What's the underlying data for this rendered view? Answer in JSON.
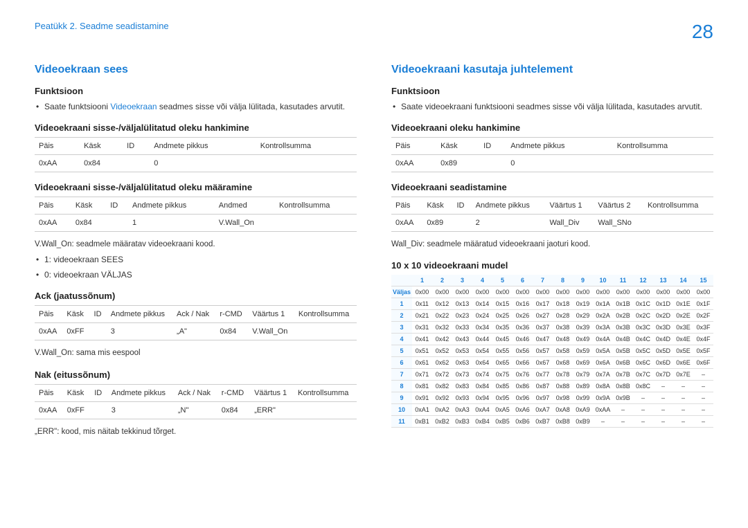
{
  "header": {
    "breadcrumb": "Peatükk 2. Seadme seadistamine",
    "page": "28"
  },
  "left": {
    "title": "Videoekraan sees",
    "func_label": "Funktsioon",
    "func_bullet_pre": "Saate funktsiooni ",
    "func_bullet_hl": "Videoekraan",
    "func_bullet_post": " seadmes sisse või välja lülitada, kasutades arvutit.",
    "get_title": "Videoekraani sisse-/väljalülitatud oleku hankimine",
    "get_headers": [
      "Päis",
      "Käsk",
      "ID",
      "Andmete pikkus",
      "Kontrollsumma"
    ],
    "get_row": [
      "0xAA",
      "0x84",
      "",
      "0",
      ""
    ],
    "set_title": "Videoekraani sisse-/väljalülitatud oleku määramine",
    "set_headers": [
      "Päis",
      "Käsk",
      "ID",
      "Andmete pikkus",
      "Andmed",
      "Kontrollsumma"
    ],
    "set_row": [
      "0xAA",
      "0x84",
      "",
      "1",
      "V.Wall_On",
      ""
    ],
    "note1": "V.Wall_On: seadmele määratav videoekraani kood.",
    "note2": "1: videoekraan SEES",
    "note3": "0: videoekraan VÄLJAS",
    "ack_title": "Ack (jaatussõnum)",
    "ack_headers": [
      "Päis",
      "Käsk",
      "ID",
      "Andmete pikkus",
      "Ack / Nak",
      "r-CMD",
      "Väärtus 1",
      "Kontrollsumma"
    ],
    "ack_row": [
      "0xAA",
      "0xFF",
      "",
      "3",
      "„A\"",
      "0x84",
      "V.Wall_On",
      ""
    ],
    "ack_note": "V.Wall_On: sama mis eespool",
    "nak_title": "Nak (eitussõnum)",
    "nak_headers": [
      "Päis",
      "Käsk",
      "ID",
      "Andmete pikkus",
      "Ack / Nak",
      "r-CMD",
      "Väärtus 1",
      "Kontrollsumma"
    ],
    "nak_row": [
      "0xAA",
      "0xFF",
      "",
      "3",
      "„N\"",
      "0x84",
      "„ERR\"",
      ""
    ],
    "nak_note": "„ERR\": kood, mis näitab tekkinud tõrget."
  },
  "right": {
    "title": "Videoekraani kasutaja juhtelement",
    "func_label": "Funktsioon",
    "func_bullet": "Saate videoekraani funktsiooni seadmes sisse või välja lülitada, kasutades arvutit.",
    "get_title": "Videoekraani oleku hankimine",
    "get_headers": [
      "Päis",
      "Käsk",
      "ID",
      "Andmete pikkus",
      "Kontrollsumma"
    ],
    "get_row": [
      "0xAA",
      "0x89",
      "",
      "0",
      ""
    ],
    "set_title": "Videoekraani seadistamine",
    "set_headers": [
      "Päis",
      "Käsk",
      "ID",
      "Andmete pikkus",
      "Väärtus 1",
      "Väärtus 2",
      "Kontrollsumma"
    ],
    "set_row": [
      "0xAA",
      "0x89",
      "",
      "2",
      "Wall_Div",
      "Wall_SNo",
      ""
    ],
    "note1": "Wall_Div: seadmele määratud videoekraani jaoturi kood.",
    "grid_title": "10 x 10 videoekraani mudel",
    "grid_cols": [
      "",
      "1",
      "2",
      "3",
      "4",
      "5",
      "6",
      "7",
      "8",
      "9",
      "10",
      "11",
      "12",
      "13",
      "14",
      "15"
    ],
    "grid_rows": [
      [
        "Väljas",
        "0x00",
        "0x00",
        "0x00",
        "0x00",
        "0x00",
        "0x00",
        "0x00",
        "0x00",
        "0x00",
        "0x00",
        "0x00",
        "0x00",
        "0x00",
        "0x00",
        "0x00"
      ],
      [
        "1",
        "0x11",
        "0x12",
        "0x13",
        "0x14",
        "0x15",
        "0x16",
        "0x17",
        "0x18",
        "0x19",
        "0x1A",
        "0x1B",
        "0x1C",
        "0x1D",
        "0x1E",
        "0x1F"
      ],
      [
        "2",
        "0x21",
        "0x22",
        "0x23",
        "0x24",
        "0x25",
        "0x26",
        "0x27",
        "0x28",
        "0x29",
        "0x2A",
        "0x2B",
        "0x2C",
        "0x2D",
        "0x2E",
        "0x2F"
      ],
      [
        "3",
        "0x31",
        "0x32",
        "0x33",
        "0x34",
        "0x35",
        "0x36",
        "0x37",
        "0x38",
        "0x39",
        "0x3A",
        "0x3B",
        "0x3C",
        "0x3D",
        "0x3E",
        "0x3F"
      ],
      [
        "4",
        "0x41",
        "0x42",
        "0x43",
        "0x44",
        "0x45",
        "0x46",
        "0x47",
        "0x48",
        "0x49",
        "0x4A",
        "0x4B",
        "0x4C",
        "0x4D",
        "0x4E",
        "0x4F"
      ],
      [
        "5",
        "0x51",
        "0x52",
        "0x53",
        "0x54",
        "0x55",
        "0x56",
        "0x57",
        "0x58",
        "0x59",
        "0x5A",
        "0x5B",
        "0x5C",
        "0x5D",
        "0x5E",
        "0x5F"
      ],
      [
        "6",
        "0x61",
        "0x62",
        "0x63",
        "0x64",
        "0x65",
        "0x66",
        "0x67",
        "0x68",
        "0x69",
        "0x6A",
        "0x6B",
        "0x6C",
        "0x6D",
        "0x6E",
        "0x6F"
      ],
      [
        "7",
        "0x71",
        "0x72",
        "0x73",
        "0x74",
        "0x75",
        "0x76",
        "0x77",
        "0x78",
        "0x79",
        "0x7A",
        "0x7B",
        "0x7C",
        "0x7D",
        "0x7E",
        "–"
      ],
      [
        "8",
        "0x81",
        "0x82",
        "0x83",
        "0x84",
        "0x85",
        "0x86",
        "0x87",
        "0x88",
        "0x89",
        "0x8A",
        "0x8B",
        "0x8C",
        "–",
        "–",
        "–"
      ],
      [
        "9",
        "0x91",
        "0x92",
        "0x93",
        "0x94",
        "0x95",
        "0x96",
        "0x97",
        "0x98",
        "0x99",
        "0x9A",
        "0x9B",
        "–",
        "–",
        "–",
        "–"
      ],
      [
        "10",
        "0xA1",
        "0xA2",
        "0xA3",
        "0xA4",
        "0xA5",
        "0xA6",
        "0xA7",
        "0xA8",
        "0xA9",
        "0xAA",
        "–",
        "–",
        "–",
        "–",
        "–"
      ],
      [
        "11",
        "0xB1",
        "0xB2",
        "0xB3",
        "0xB4",
        "0xB5",
        "0xB6",
        "0xB7",
        "0xB8",
        "0xB9",
        "–",
        "–",
        "–",
        "–",
        "–",
        "–"
      ]
    ]
  }
}
